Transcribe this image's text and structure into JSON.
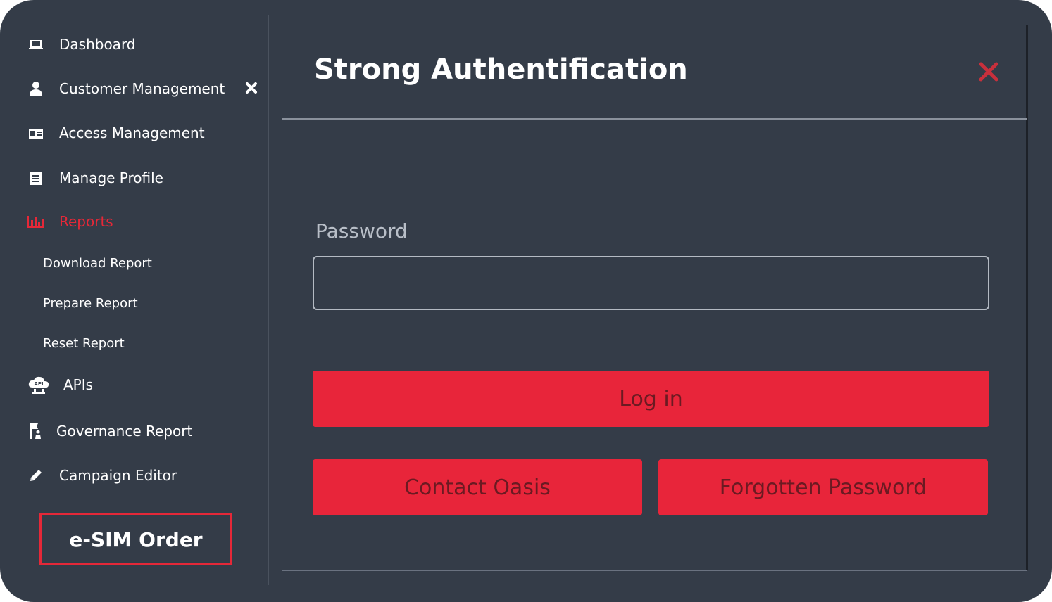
{
  "sidebar": {
    "items": [
      {
        "label": "Dashboard",
        "icon": "laptop-icon"
      },
      {
        "label": "Customer Management",
        "icon": "user-icon"
      },
      {
        "label": "Access Management",
        "icon": "id-card-icon"
      },
      {
        "label": "Manage Profile",
        "icon": "document-icon"
      },
      {
        "label": "Reports",
        "icon": "bar-chart-icon",
        "active": true
      },
      {
        "label": "APIs",
        "icon": "api-cloud-icon"
      },
      {
        "label": "Governance Report",
        "icon": "flag-person-icon"
      },
      {
        "label": "Campaign Editor",
        "icon": "pencil-icon"
      }
    ],
    "sub_items": [
      "Download Report",
      "Prepare Report",
      "Reset Report"
    ],
    "esim_label": "e-SIM Order"
  },
  "modal": {
    "title": "Strong Authentification",
    "password_label": "Password",
    "password_value": "",
    "login_label": "Log in",
    "contact_label": "Contact Oasis",
    "forgot_label": "Forgotten Password"
  },
  "colors": {
    "background": "#343c48",
    "accent": "#e52838",
    "button": "#e8253a",
    "button_text": "#6b1a22"
  }
}
